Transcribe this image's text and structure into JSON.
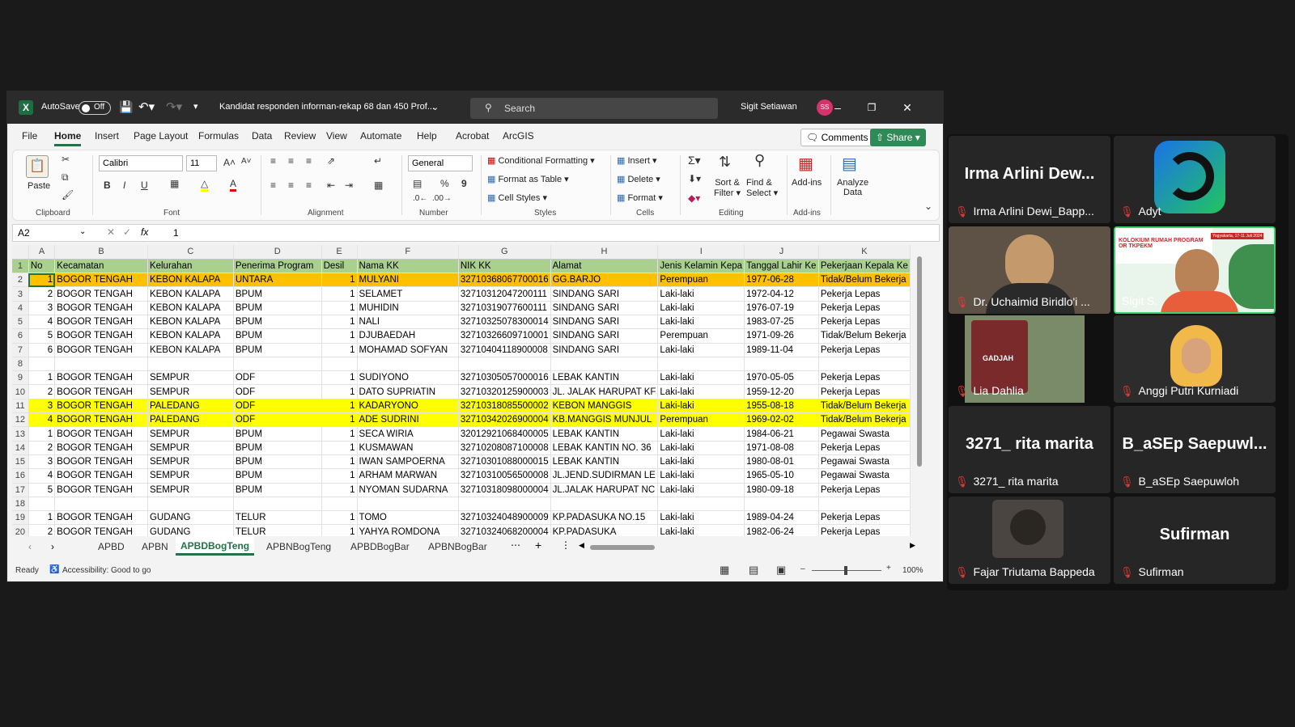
{
  "window": {
    "app_icon": "excel-icon",
    "autosave_label": "AutoSave",
    "autosave_state": "Off",
    "file_title": "Kandidat responden informan-rekap 68 dan 450 Prof...",
    "search_placeholder": "Search",
    "user_name": "Sigit Setiawan",
    "user_initials": "SS"
  },
  "menu": {
    "tabs": [
      "File",
      "Home",
      "Insert",
      "Page Layout",
      "Formulas",
      "Data",
      "Review",
      "View",
      "Automate",
      "Help",
      "Acrobat",
      "ArcGIS"
    ],
    "active": "Home",
    "comments": "Comments",
    "share": "Share"
  },
  "ribbon": {
    "paste": "Paste",
    "clipboard": "Clipboard",
    "font_name": "Calibri",
    "font_size": "11",
    "font": "Font",
    "alignment": "Alignment",
    "number_format": "General",
    "number": "Number",
    "conditional_formatting": "Conditional Formatting",
    "format_as_table": "Format as Table",
    "cell_styles": "Cell Styles",
    "styles": "Styles",
    "insert": "Insert",
    "delete": "Delete",
    "format": "Format",
    "cells": "Cells",
    "sort_filter_1": "Sort &",
    "sort_filter_2": "Filter",
    "find_select_1": "Find &",
    "find_select_2": "Select",
    "editing": "Editing",
    "add_ins": "Add-ins",
    "add_ins_group": "Add-ins",
    "analyze_1": "Analyze",
    "analyze_2": "Data"
  },
  "formula_bar": {
    "name_box": "A2",
    "value": "1"
  },
  "sheet": {
    "columns": [
      "A",
      "B",
      "C",
      "D",
      "E",
      "F",
      "G",
      "H",
      "I",
      "J",
      "K"
    ],
    "header_row": [
      "No",
      "Kecamatan",
      "Kelurahan",
      "Penerima Program",
      "Desil",
      "Nama KK",
      "NIK KK",
      "Alamat",
      "Jenis Kelamin Kepa",
      "Tanggal Lahir Ke",
      "Pekerjaan Kepala Ke"
    ],
    "rows": [
      {
        "n": "2",
        "hl": "orange",
        "c": [
          "1",
          "BOGOR TENGAH",
          "KEBON KALAPA",
          "UNTARA",
          "1",
          "MULYANI",
          "32710368067700016",
          "GG.BARJO",
          "Perempuan",
          "1977-06-28",
          "Tidak/Belum Bekerja"
        ]
      },
      {
        "n": "3",
        "hl": "",
        "c": [
          "2",
          "BOGOR TENGAH",
          "KEBON KALAPA",
          "BPUM",
          "1",
          "SELAMET",
          "32710312047200111",
          "SINDANG SARI",
          "Laki-laki",
          "1972-04-12",
          "Pekerja Lepas"
        ]
      },
      {
        "n": "4",
        "hl": "",
        "c": [
          "3",
          "BOGOR TENGAH",
          "KEBON KALAPA",
          "BPUM",
          "1",
          "MUHIDIN",
          "32710319077600111",
          "SINDANG SARI",
          "Laki-laki",
          "1976-07-19",
          "Pekerja Lepas"
        ]
      },
      {
        "n": "5",
        "hl": "",
        "c": [
          "4",
          "BOGOR TENGAH",
          "KEBON KALAPA",
          "BPUM",
          "1",
          "NALI",
          "32710325078300014",
          "SINDANG SARI",
          "Laki-laki",
          "1983-07-25",
          "Pekerja Lepas"
        ]
      },
      {
        "n": "6",
        "hl": "",
        "c": [
          "5",
          "BOGOR TENGAH",
          "KEBON KALAPA",
          "BPUM",
          "1",
          "DJUBAEDAH",
          "32710326609710001",
          "SINDANG SARI",
          "Perempuan",
          "1971-09-26",
          "Tidak/Belum Bekerja"
        ]
      },
      {
        "n": "7",
        "hl": "",
        "c": [
          "6",
          "BOGOR TENGAH",
          "KEBON KALAPA",
          "BPUM",
          "1",
          "MOHAMAD SOFYAN",
          "32710404118900008",
          "SINDANG SARI",
          "Laki-laki",
          "1989-11-04",
          "Pekerja Lepas"
        ]
      },
      {
        "n": "8",
        "hl": "",
        "c": [
          "",
          "",
          "",
          "",
          "",
          "",
          "",
          "",
          "",
          "",
          ""
        ]
      },
      {
        "n": "9",
        "hl": "",
        "c": [
          "1",
          "BOGOR TENGAH",
          "SEMPUR",
          "ODF",
          "1",
          "SUDIYONO",
          "32710305057000016",
          "LEBAK KANTIN",
          "Laki-laki",
          "1970-05-05",
          "Pekerja Lepas"
        ]
      },
      {
        "n": "10",
        "hl": "",
        "c": [
          "2",
          "BOGOR TENGAH",
          "SEMPUR",
          "ODF",
          "1",
          "DATO SUPRIATIN",
          "32710320125900003",
          "JL. JALAK HARUPAT KF",
          "Laki-laki",
          "1959-12-20",
          "Pekerja Lepas"
        ]
      },
      {
        "n": "11",
        "hl": "yellow",
        "c": [
          "3",
          "BOGOR TENGAH",
          "PALEDANG",
          "ODF",
          "1",
          "KADARYONO",
          "32710318085500002",
          "KEBON MANGGIS",
          "Laki-laki",
          "1955-08-18",
          "Tidak/Belum Bekerja"
        ]
      },
      {
        "n": "12",
        "hl": "yellow",
        "c": [
          "4",
          "BOGOR TENGAH",
          "PALEDANG",
          "ODF",
          "1",
          "ADE SUDRINI",
          "32710342026900004",
          "KB.MANGGIS MUNJUL",
          "Perempuan",
          "1969-02-02",
          "Tidak/Belum Bekerja"
        ]
      },
      {
        "n": "13",
        "hl": "",
        "c": [
          "1",
          "BOGOR TENGAH",
          "SEMPUR",
          "BPUM",
          "1",
          "SECA WIRIA",
          "32012921068400005",
          "LEBAK KANTIN",
          "Laki-laki",
          "1984-06-21",
          "Pegawai Swasta"
        ]
      },
      {
        "n": "14",
        "hl": "",
        "c": [
          "2",
          "BOGOR TENGAH",
          "SEMPUR",
          "BPUM",
          "1",
          "KUSMAWAN",
          "32710208087100008",
          "LEBAK KANTIN NO. 36",
          "Laki-laki",
          "1971-08-08",
          "Pekerja Lepas"
        ]
      },
      {
        "n": "15",
        "hl": "",
        "c": [
          "3",
          "BOGOR TENGAH",
          "SEMPUR",
          "BPUM",
          "1",
          "IWAN SAMPOERNA",
          "32710301088000015",
          "LEBAK KANTIN",
          "Laki-laki",
          "1980-08-01",
          "Pegawai Swasta"
        ]
      },
      {
        "n": "16",
        "hl": "",
        "c": [
          "4",
          "BOGOR TENGAH",
          "SEMPUR",
          "BPUM",
          "1",
          "ARHAM MARWAN",
          "32710310056500008",
          "JL.JEND.SUDIRMAN LE",
          "Laki-laki",
          "1965-05-10",
          "Pegawai Swasta"
        ]
      },
      {
        "n": "17",
        "hl": "",
        "c": [
          "5",
          "BOGOR TENGAH",
          "SEMPUR",
          "BPUM",
          "1",
          "NYOMAN SUDARNA",
          "32710318098000004",
          "JL.JALAK HARUPAT NC",
          "Laki-laki",
          "1980-09-18",
          "Pekerja Lepas"
        ]
      },
      {
        "n": "18",
        "hl": "",
        "c": [
          "",
          "",
          "",
          "",
          "",
          "",
          "",
          "",
          "",
          "",
          ""
        ]
      },
      {
        "n": "19",
        "hl": "",
        "c": [
          "1",
          "BOGOR TENGAH",
          "GUDANG",
          "TELUR",
          "1",
          "TOMO",
          "32710324048900009",
          "KP.PADASUKA NO.15",
          "Laki-laki",
          "1989-04-24",
          "Pekerja Lepas"
        ]
      },
      {
        "n": "20",
        "hl": "",
        "c": [
          "2",
          "BOGOR TENGAH",
          "GUDANG",
          "TELUR",
          "1",
          "YAHYA ROMDONA",
          "32710324068200004",
          "KP.PADASUKA",
          "Laki-laki",
          "1982-06-24",
          "Pekerja Lepas"
        ]
      }
    ],
    "tabs": [
      "APBD",
      "APBN",
      "APBDBogTeng",
      "APBNBogTeng",
      "APBDBogBar",
      "APBNBogBar"
    ],
    "active_tab": "APBDBogTeng"
  },
  "status": {
    "ready": "Ready",
    "accessibility": "Accessibility: Good to go",
    "zoom": "100%"
  },
  "meeting": {
    "participants": [
      {
        "big": "Irma Arlini Dew...",
        "name": "Irma Arlini Dewi_Bapp..."
      },
      {
        "big": "",
        "name": "Adyt"
      },
      {
        "big": "",
        "name": "Dr. Uchaimid Biridlo'i ..."
      },
      {
        "big": "",
        "name": "Sigit S."
      },
      {
        "big": "",
        "name": "Lia Dahlia"
      },
      {
        "big": "",
        "name": "Anggi Putri Kurniadi"
      },
      {
        "big": "3271_ rita marita",
        "name": "3271_ rita marita"
      },
      {
        "big": "B_aSEp Saepuwl...",
        "name": "B_aSEp Saepuwloh"
      },
      {
        "big": "",
        "name": "Fajar Triutama Bappeda"
      },
      {
        "big": "Sufirman",
        "name": "Sufirman"
      }
    ],
    "slide_title_1": "KOLOKIUM RUMAH PROGRAM",
    "slide_title_2": "OR TKPEKM",
    "slide_place": "Yogyakarta, 17-11 Juli 2024",
    "cafe_text": "GADJAH"
  },
  "colors": {
    "excel_green": "#217346",
    "header_green": "#a9d08e",
    "highlight_orange": "#ffc000",
    "highlight_yellow": "#ffff00",
    "active_speaker": "#3ecf6e",
    "muted_red": "#e53935"
  }
}
